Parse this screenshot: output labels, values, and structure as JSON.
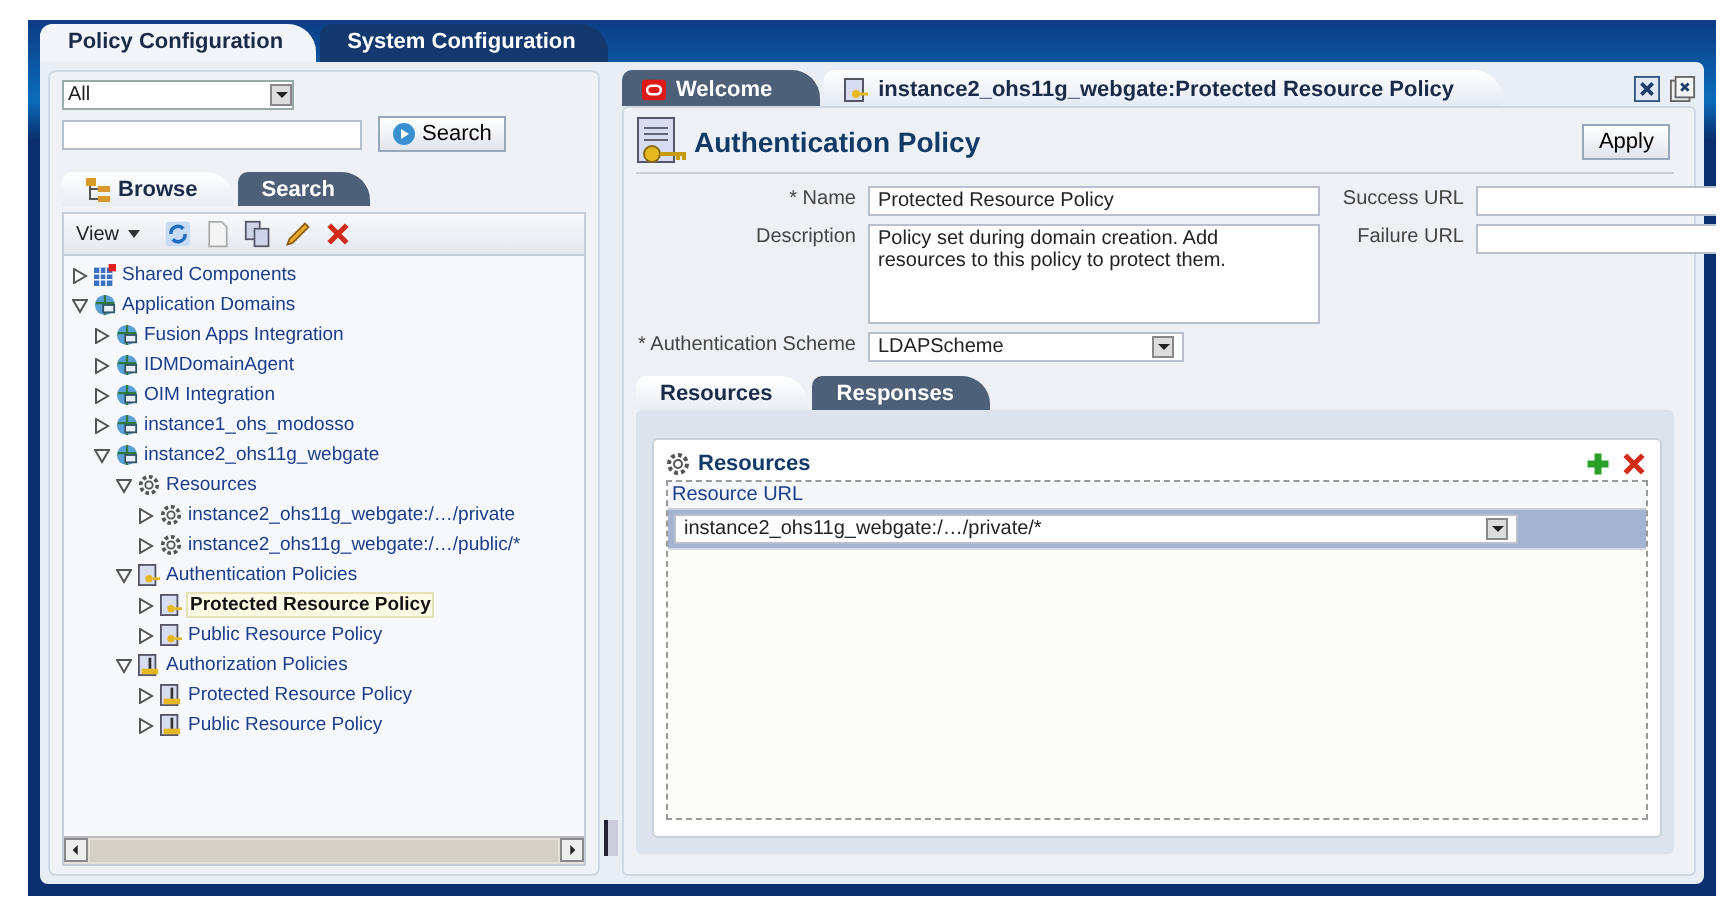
{
  "top_tabs": [
    {
      "label": "Policy Configuration",
      "selected": true
    },
    {
      "label": "System Configuration",
      "selected": false
    }
  ],
  "left": {
    "filter": "All",
    "search_button": "Search",
    "tabs": [
      {
        "label": "Browse",
        "selected": true
      },
      {
        "label": "Search",
        "selected": false
      }
    ],
    "view_menu": "View",
    "tree": [
      {
        "label": "Shared Components",
        "kind": "grid",
        "expanded": false,
        "selected": false
      },
      {
        "label": "Application Domains",
        "kind": "domain",
        "expanded": true,
        "selected": false,
        "children": [
          {
            "label": "Fusion Apps Integration",
            "kind": "domain",
            "expanded": false,
            "selected": false
          },
          {
            "label": "IDMDomainAgent",
            "kind": "domain",
            "expanded": false,
            "selected": false
          },
          {
            "label": "OIM Integration",
            "kind": "domain",
            "expanded": false,
            "selected": false
          },
          {
            "label": "instance1_ohs_modosso",
            "kind": "domain",
            "expanded": false,
            "selected": false
          },
          {
            "label": "instance2_ohs11g_webgate",
            "kind": "domain",
            "expanded": true,
            "selected": false,
            "children": [
              {
                "label": "Resources",
                "kind": "gear",
                "expanded": true,
                "selected": false,
                "children": [
                  {
                    "label": "instance2_ohs11g_webgate:/…/private",
                    "kind": "gear",
                    "expanded": false,
                    "selected": false
                  },
                  {
                    "label": "instance2_ohs11g_webgate:/…/public/*",
                    "kind": "gear",
                    "expanded": false,
                    "selected": false
                  }
                ]
              },
              {
                "label": "Authentication Policies",
                "kind": "authn",
                "expanded": true,
                "selected": false,
                "children": [
                  {
                    "label": "Protected Resource Policy",
                    "kind": "authn",
                    "expanded": false,
                    "selected": true
                  },
                  {
                    "label": "Public Resource Policy",
                    "kind": "authn",
                    "expanded": false,
                    "selected": false
                  }
                ]
              },
              {
                "label": "Authorization Policies",
                "kind": "authz",
                "expanded": true,
                "selected": false,
                "children": [
                  {
                    "label": "Protected Resource Policy",
                    "kind": "authz",
                    "expanded": false,
                    "selected": false
                  },
                  {
                    "label": "Public Resource Policy",
                    "kind": "authz",
                    "expanded": false,
                    "selected": false
                  }
                ]
              }
            ]
          }
        ]
      }
    ]
  },
  "doc_tabs": [
    {
      "label": "Welcome",
      "kind": "oracle",
      "selected": false
    },
    {
      "label": "instance2_ohs11g_webgate:Protected Resource Policy",
      "kind": "policy",
      "selected": true
    }
  ],
  "policy": {
    "title": "Authentication Policy",
    "apply": "Apply",
    "name_label": "* Name",
    "name": "Protected Resource Policy",
    "description_label": "Description",
    "description": "Policy set during domain creation. Add resources to this policy to protect them.",
    "scheme_label": "* Authentication Scheme",
    "scheme": "LDAPScheme",
    "success_url_label": "Success URL",
    "failure_url_label": "Failure URL"
  },
  "sub_tabs": [
    {
      "label": "Resources",
      "selected": true
    },
    {
      "label": "Responses",
      "selected": false
    }
  ],
  "resources": {
    "title": "Resources",
    "column": "Resource URL",
    "rows": [
      {
        "value": "instance2_ohs11g_webgate:/…/private/*",
        "selected": true
      }
    ]
  }
}
